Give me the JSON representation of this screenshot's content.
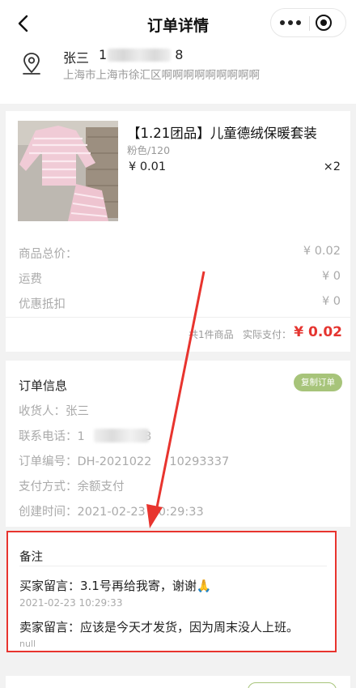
{
  "navbar": {
    "title": "订单详情"
  },
  "address": {
    "name": "张三",
    "phone_start": "1",
    "phone_end": "8",
    "detail": "上海市上海市徐汇区啊啊啊啊啊啊啊啊啊"
  },
  "goods": {
    "title": "【1.21团品】儿童德绒保暖套装",
    "spec": "粉色/120",
    "price": "¥ 0.01",
    "qty": "×2",
    "rows": [
      {
        "label": "商品总价：",
        "value": "¥ 0.02"
      },
      {
        "label": "运费",
        "value": "¥ 0"
      },
      {
        "label": "优惠抵扣",
        "value": "¥ 0"
      }
    ],
    "total_count": "共1件商品",
    "total_label": "实际支付：",
    "total_value": "¥ 0.02"
  },
  "order_info": {
    "title": "订单信息",
    "copy_button": "复制订单",
    "receiver": "收货人：张三",
    "phone_label": "联系电话：",
    "phone_prefix": "1",
    "phone_suffix": "78",
    "order_no_label": "订单编号：",
    "order_no_prefix": "DH-2021022",
    "order_no_suffix": "10293337",
    "pay_method": "支付方式：余额支付",
    "created_label": "创建时间：",
    "created_prefix": "2021-02-23",
    "created_suffix": "0:29:33"
  },
  "remark": {
    "title": "备注",
    "buyer_message": "买家留言：3.1号再给我寄，谢谢🙏",
    "buyer_time": "2021-02-23 10:29:33",
    "seller_message": "卖家留言：应该是今天才发货，因为周末没人上班。",
    "null_text": "null"
  },
  "colors": {
    "accent_red": "#e53530",
    "annotation_red": "#e8342e",
    "copy_button_green": "#a7c47a"
  }
}
